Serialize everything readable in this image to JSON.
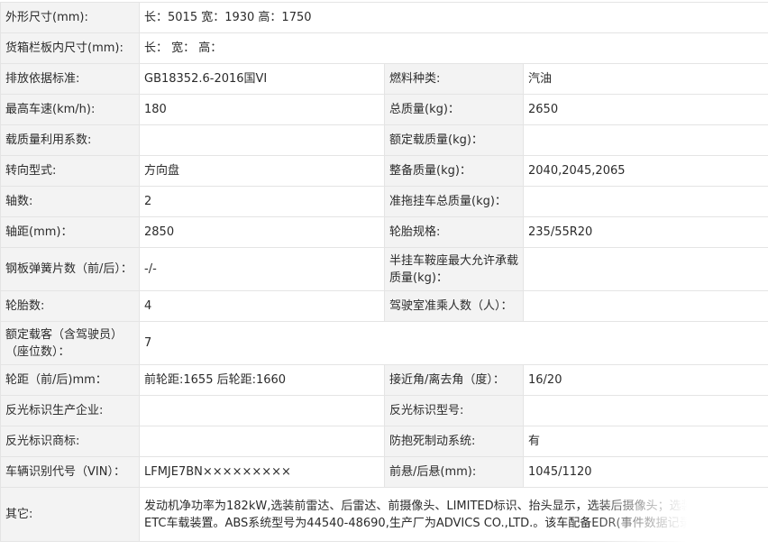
{
  "rows": [
    {
      "label": "外形尺寸(mm):",
      "value": "长：5015 宽：1930 高：1750"
    },
    {
      "label": "货箱栏板内尺寸(mm):",
      "value": "长：  宽：  高："
    },
    {
      "label": "排放依据标准:",
      "value": "GB18352.6-2016国VI",
      "label2": "燃料种类:",
      "value2": "汽油"
    },
    {
      "label": "最高车速(km/h):",
      "value": "180",
      "label2": "总质量(kg)：",
      "value2": "2650"
    },
    {
      "label": "载质量利用系数:",
      "value": "",
      "label2": "额定载质量(kg)：",
      "value2": ""
    },
    {
      "label": "转向型式:",
      "value": "方向盘",
      "label2": "整备质量(kg)：",
      "value2": "2040,2045,2065"
    },
    {
      "label": "轴数:",
      "value": "2",
      "label2": "准拖挂车总质量(kg)：",
      "value2": ""
    },
    {
      "label": "轴距(mm)：",
      "value": "2850",
      "label2": "轮胎规格:",
      "value2": "235/55R20"
    },
    {
      "label": "钢板弹簧片数（前/后）：",
      "value": "-/-",
      "label2": "半挂车鞍座最大允许承载质量(kg)：",
      "value2": ""
    },
    {
      "label": "轮胎数:",
      "value": "4",
      "label2": "驾驶室准乘人数（人）：",
      "value2": ""
    },
    {
      "label": "额定载客（含驾驶员）（座位数）：",
      "value": "7"
    },
    {
      "label": "轮距（前/后)mm：",
      "value": "前轮距:1655 后轮距:1660",
      "label2": "接近角/离去角（度）：",
      "value2": "16/20"
    },
    {
      "label": "反光标识生产企业:",
      "value": "",
      "label2": "反光标识型号:",
      "value2": ""
    },
    {
      "label": "反光标识商标:",
      "value": "",
      "label2": "防抱死制动系统:",
      "value2": "有"
    },
    {
      "label": "车辆识别代号（VIN）：",
      "value": "LFMJE7BN×××××××××",
      "label2": "前悬/后悬(mm):",
      "value2": "1045/1120"
    },
    {
      "label": "其它:",
      "value": "发动机净功率为182kW,选装前雷达、后雷达、前摄像头、LIMITED标识、抬头显示，选装后摄像头；选装车型可选装ETC车载装置。ABS系统型号为44540-48690,生产厂为ADVICS CO.,LTD.。该车配备EDR(事件数据记录器)。"
    }
  ]
}
